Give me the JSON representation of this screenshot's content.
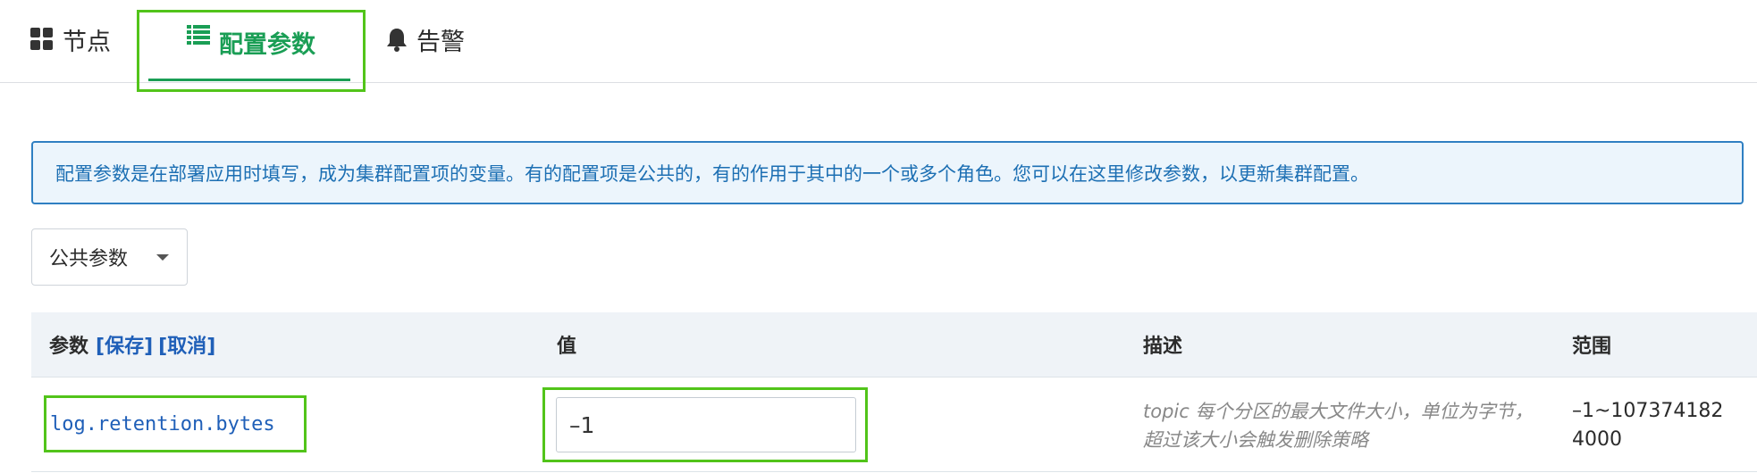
{
  "tabs": [
    {
      "label": "节点",
      "icon": "grid-icon"
    },
    {
      "label": "配置参数",
      "icon": "list-icon",
      "active": true
    },
    {
      "label": "告警",
      "icon": "bell-icon"
    }
  ],
  "info": "配置参数是在部署应用时填写，成为集群配置项的变量。有的配置项是公共的，有的作用于其中的一个或多个角色。您可以在这里修改参数，以更新集群配置。",
  "filter": {
    "selected": "公共参数"
  },
  "table": {
    "headers": {
      "param": "参数",
      "save": "[保存]",
      "cancel": "[取消]",
      "value": "值",
      "desc": "描述",
      "range": "范围"
    },
    "rows": [
      {
        "param": "log.retention.bytes",
        "value": "–1",
        "desc": "topic 每个分区的最大文件大小，单位为字节，超过该大小会触发删除策略",
        "range": "–1~1073741824000"
      }
    ]
  },
  "colors": {
    "accent": "#1a9e55",
    "highlight": "#52c41a",
    "info": "#1c6fb3",
    "link": "#1f5fb8"
  }
}
